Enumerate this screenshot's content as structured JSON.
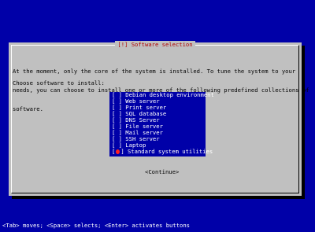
{
  "dialog": {
    "title": "[!] Software selection",
    "description_lines": [
      "At the moment, only the core of the system is installed. To tune the system to your",
      "needs, you can choose to install one or more of the following predefined collections of",
      "software."
    ],
    "prompt": "Choose software to install:",
    "software_options": [
      {
        "label": "Debian desktop environment",
        "checked": false
      },
      {
        "label": "Web server",
        "checked": false
      },
      {
        "label": "Print server",
        "checked": false
      },
      {
        "label": "SQL database",
        "checked": false
      },
      {
        "label": "DNS Server",
        "checked": false
      },
      {
        "label": "File server",
        "checked": false
      },
      {
        "label": "Mail server",
        "checked": false
      },
      {
        "label": "SSH server",
        "checked": false
      },
      {
        "label": "Laptop",
        "checked": false
      },
      {
        "label": "Standard system utilities",
        "checked": true,
        "focused": true
      }
    ],
    "continue_label": "<Continue>"
  },
  "help_bar": "<Tab> moves; <Space> selects; <Enter> activates buttons",
  "colors": {
    "background": "#0000a8",
    "dialog": "#c0c0c0",
    "title_text": "#b00000",
    "list_background": "#0000a8",
    "list_text": "#ffffff",
    "cursor": "#ff2020"
  }
}
